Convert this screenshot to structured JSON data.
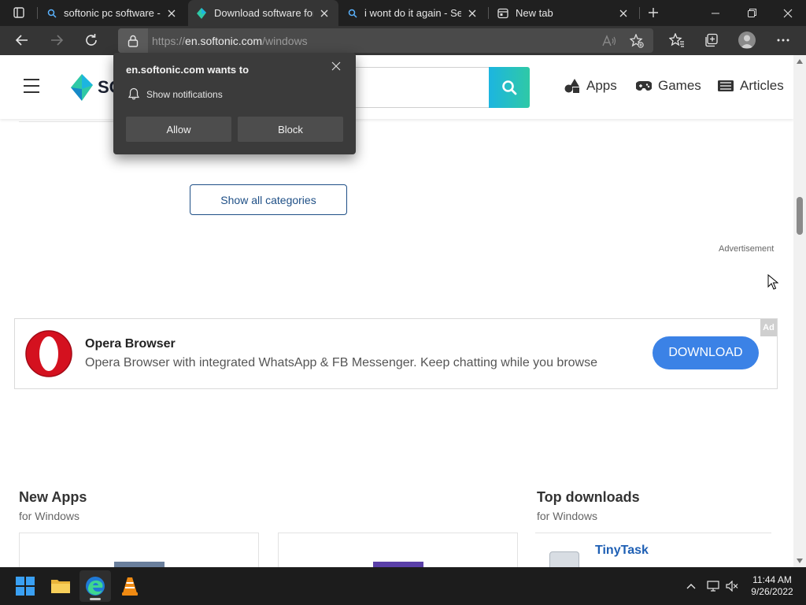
{
  "browser": {
    "tabs": [
      {
        "title": "softonic pc software - S",
        "active": false,
        "icon": "search-icon"
      },
      {
        "title": "Download software for",
        "active": true,
        "icon": "softonic-favicon"
      },
      {
        "title": "i wont do it again - Sea",
        "active": false,
        "icon": "search-icon"
      },
      {
        "title": "New tab",
        "active": false,
        "icon": "new-tab-page-icon"
      }
    ],
    "address": {
      "scheme": "https://",
      "host": "en.softonic.com",
      "path": "/windows"
    }
  },
  "site": {
    "logo_text": "SO",
    "nav": [
      {
        "label": "Apps",
        "icon": "apps-icon"
      },
      {
        "label": "Games",
        "icon": "gamepad-icon"
      },
      {
        "label": "Articles",
        "icon": "articles-icon"
      }
    ],
    "show_all_label": "Show all categories",
    "advertisement_label": "Advertisement",
    "ad": {
      "title": "Opera Browser",
      "description": "Opera Browser with integrated WhatsApp & FB Messenger. Keep chatting while you browse",
      "button": "DOWNLOAD",
      "badge": "Ad"
    },
    "new_apps": {
      "title": "New Apps",
      "subtitle": "for Windows"
    },
    "top_downloads": {
      "title": "Top downloads",
      "subtitle": "for Windows",
      "first_item": "TinyTask"
    }
  },
  "permission_popup": {
    "title": "en.softonic.com wants to",
    "request": "Show notifications",
    "allow": "Allow",
    "block": "Block"
  },
  "taskbar": {
    "time": "11:44 AM",
    "date": "9/26/2022"
  },
  "colors": {
    "brand_teal": "#2fc9a6",
    "download_blue": "#3b82e6",
    "link_blue": "#1e5fb4"
  }
}
